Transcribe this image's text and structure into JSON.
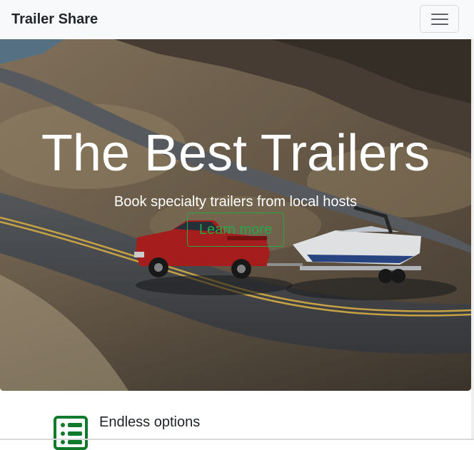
{
  "navbar": {
    "brand": "Trailer Share",
    "toggler_icon": "hamburger-menu-icon"
  },
  "hero": {
    "image": "red pickup truck towing a boat on a mountain road",
    "title": "The Best Trailers",
    "subtitle": "Book specialty trailers from local hosts",
    "button_label": "Learn more"
  },
  "features": [
    {
      "icon": "list-icon",
      "title": "Endless options"
    }
  ],
  "colors": {
    "navbar_bg": "#f8f9fa",
    "accent_green": "#28a745",
    "text_dark": "#212529"
  }
}
